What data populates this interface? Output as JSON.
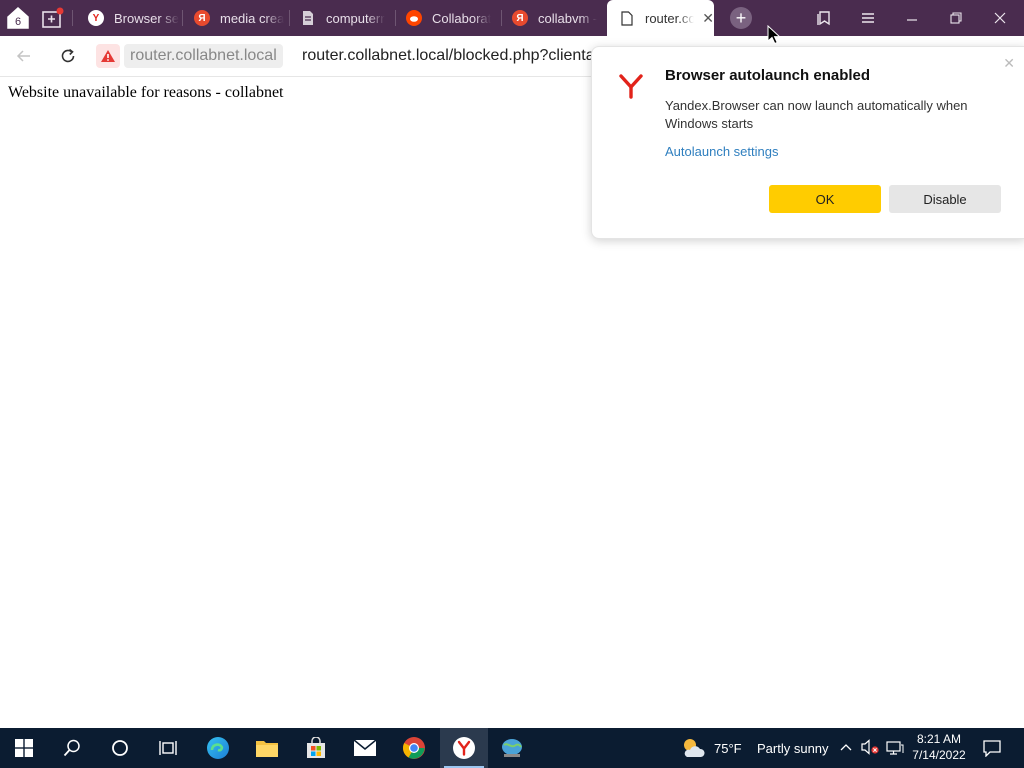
{
  "tab_counter": "6",
  "tabs": [
    {
      "title": "Browser se",
      "icon": "yandex-icon"
    },
    {
      "title": "media crea",
      "icon": "yandex-ya-icon"
    },
    {
      "title": "computerr",
      "icon": "document-icon"
    },
    {
      "title": "Collaborat",
      "icon": "reddit-icon"
    },
    {
      "title": "collabvm -",
      "icon": "yandex-ya-icon"
    },
    {
      "title": "router.co",
      "icon": "page-icon",
      "active": true
    }
  ],
  "address": {
    "domain": "router.collabnet.local",
    "url": "router.collabnet.local/blocked.php?clientaddr"
  },
  "page": {
    "message": "Website unavailable for reasons - collabnet"
  },
  "popup": {
    "title": "Browser autolaunch enabled",
    "body": "Yandex.Browser can now launch automatically when Windows starts",
    "link": "Autolaunch settings",
    "ok_label": "OK",
    "disable_label": "Disable"
  },
  "taskbar": {
    "weather_temp": "75°F",
    "weather_text": "Partly sunny",
    "time": "8:21 AM",
    "date": "7/14/2022"
  },
  "colors": {
    "tabbar": "#4a2c4f",
    "ok_button": "#ffcc00",
    "link": "#2f7fbf",
    "taskbar": "#0b1c31"
  }
}
